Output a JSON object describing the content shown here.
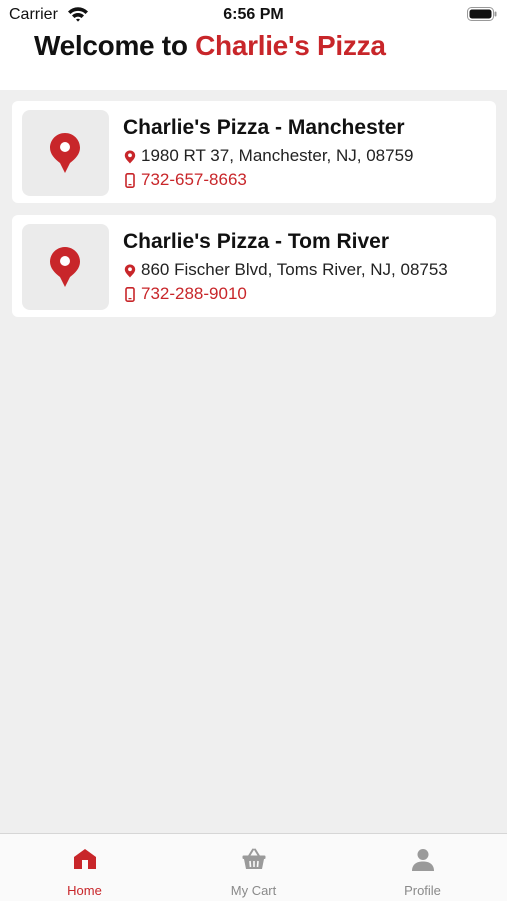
{
  "status_bar": {
    "carrier": "Carrier",
    "time": "6:56 PM"
  },
  "header": {
    "title_prefix": "Welcome to",
    "title_brand": "Charlie's Pizza"
  },
  "stores": [
    {
      "name": "Charlie's Pizza - Manchester",
      "address": "1980 RT 37, Manchester, NJ, 08759",
      "phone": "732-657-8663"
    },
    {
      "name": "Charlie's Pizza - Tom River",
      "address": "860 Fischer Blvd, Toms River, NJ, 08753",
      "phone": "732-288-9010"
    }
  ],
  "tabs": [
    {
      "label": "Home",
      "icon": "home-icon",
      "active": true
    },
    {
      "label": "My Cart",
      "icon": "basket-icon",
      "active": false
    },
    {
      "label": "Profile",
      "icon": "person-icon",
      "active": false
    }
  ],
  "colors": {
    "accent": "#c8262a",
    "inactive_tab": "#8a8a8a",
    "background": "#efefef"
  }
}
